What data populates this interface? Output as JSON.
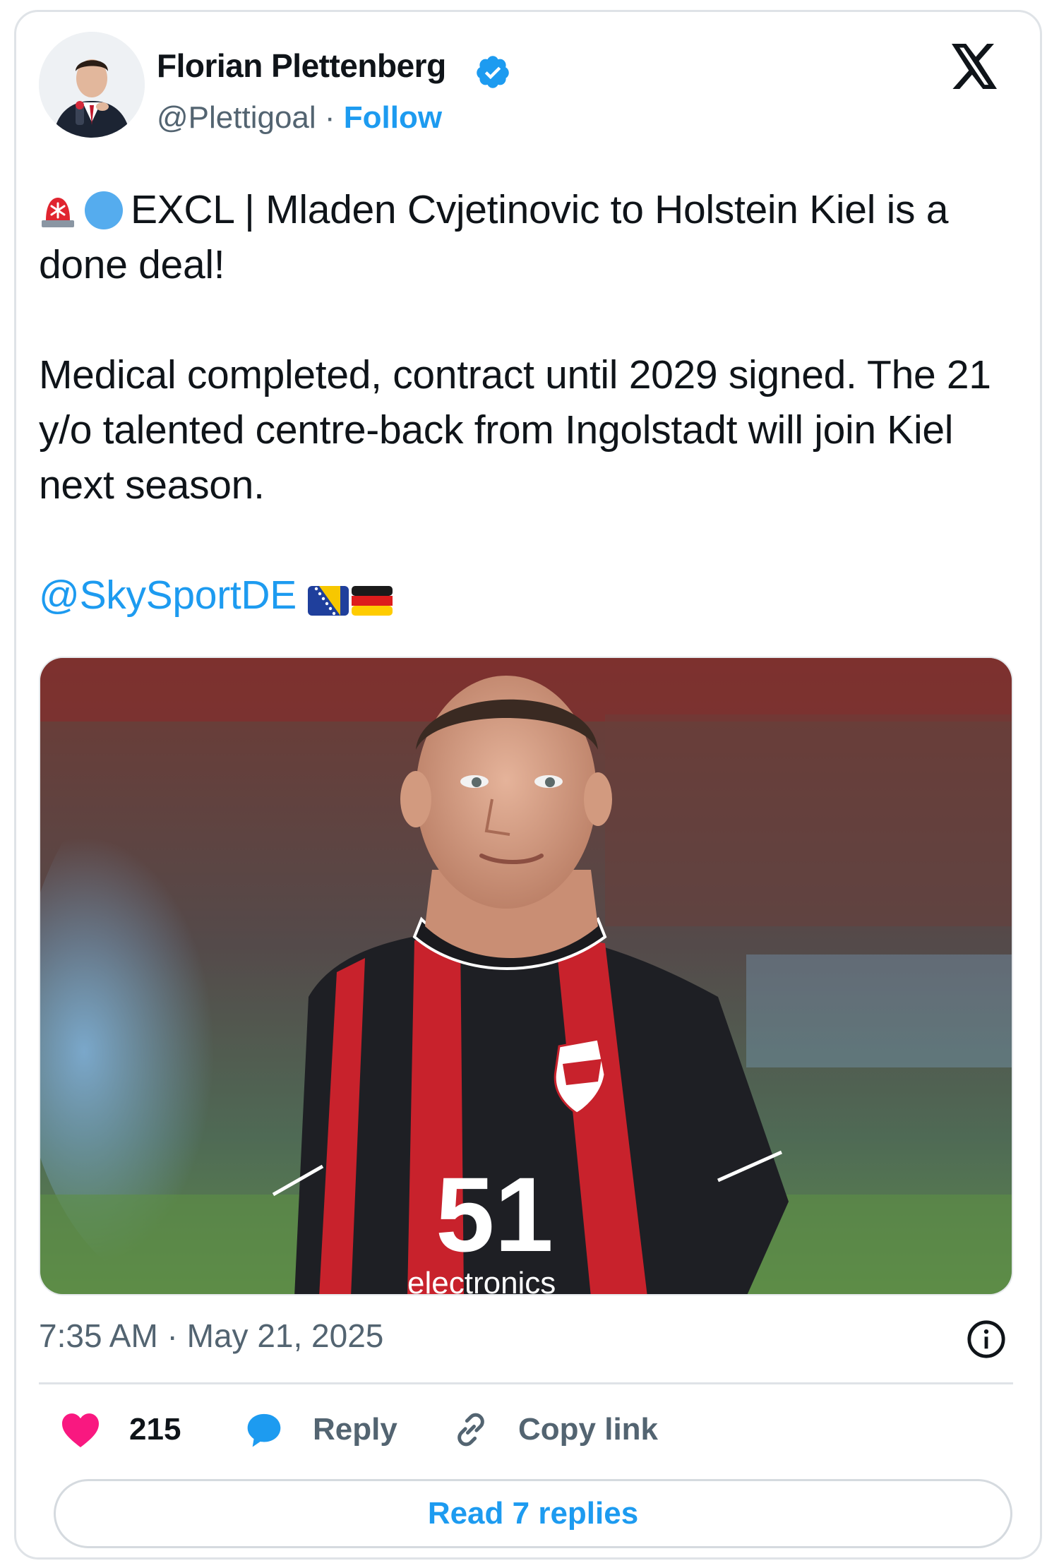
{
  "author": {
    "name": "Florian Plettenberg",
    "handle": "@Plettigoal",
    "separator": " · ",
    "follow_label": "Follow",
    "verified": true
  },
  "tweet": {
    "line1": "EXCL | Mladen Cvjetinovic to Holstein Kiel is a done deal!",
    "paragraph2": "Medical completed, contract until 2029 signed. The 21 y/o talented centre-back from Ingolstadt will join Kiel next season.",
    "mention": "@SkySportDE",
    "emojis": [
      "rotating-light-emoji",
      "blue-circle-emoji",
      "bosnia-flag-emoji",
      "germany-flag-emoji"
    ]
  },
  "media": {
    "shirt_number": "51",
    "sponsor_text": "electronics"
  },
  "meta": {
    "time": "7:35 AM · May 21, 2025"
  },
  "actions": {
    "like_count": "215",
    "reply_label": "Reply",
    "copy_label": "Copy link",
    "read_replies_label": "Read 7 replies"
  },
  "colors": {
    "accent": "#1d9bf0",
    "text": "#0f1419",
    "muted": "#536471",
    "like": "#f91880"
  }
}
